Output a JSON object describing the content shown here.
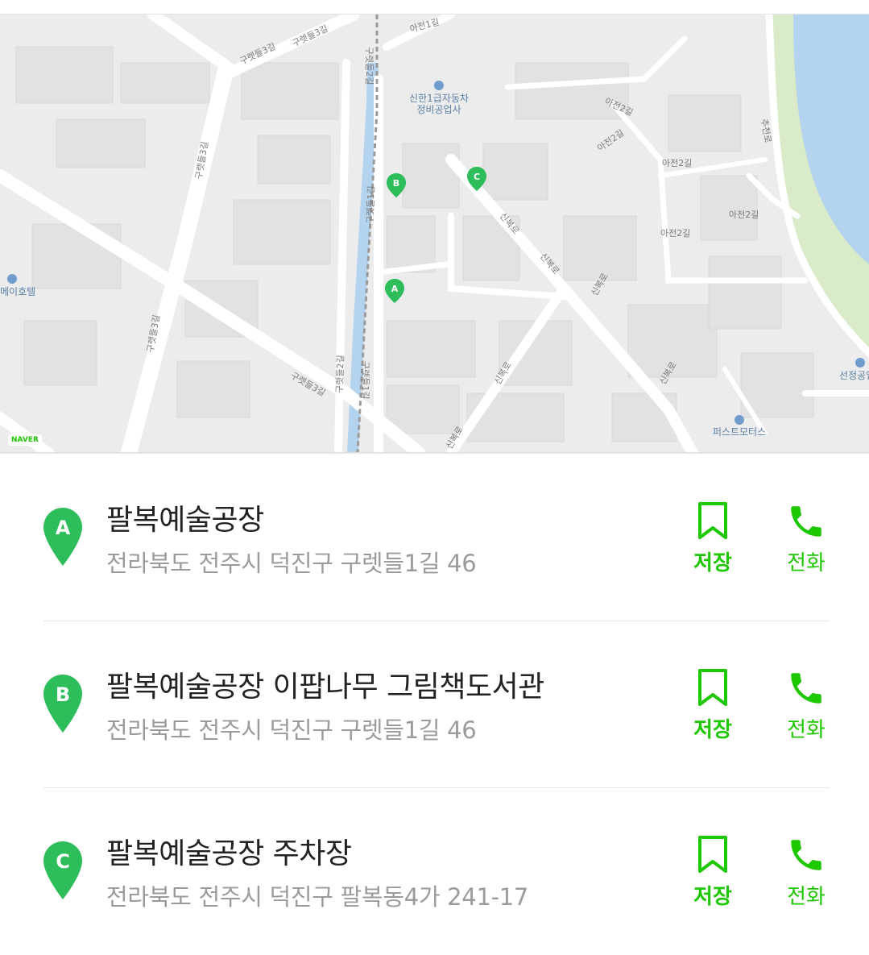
{
  "map": {
    "pins": [
      {
        "letter": "A"
      },
      {
        "letter": "B"
      },
      {
        "letter": "C"
      }
    ],
    "labels": {
      "road1": "구렛들3길",
      "road2": "구렛들3길",
      "road3": "구렛들3길",
      "road4": "구렛들2길",
      "road5": "구렛들1길",
      "road6": "구렛들2길",
      "road7": "신복로",
      "road8": "아전1길",
      "road9": "아전2길",
      "road10": "아전2길",
      "road11": "아전2길",
      "road12": "아전2길",
      "road13": "추천로",
      "poi1_line1": "신한1급자동차",
      "poi1_line2": "정비공업사",
      "poi2": "메이호텔",
      "poi3": "선정공업",
      "poi4": "퍼스트모터스"
    },
    "brand": "NAVER"
  },
  "results": [
    {
      "letter": "A",
      "name": "팔복예술공장",
      "address": "전라북도 전주시 덕진구 구렛들1길 46",
      "save_label": "저장",
      "call_label": "전화"
    },
    {
      "letter": "B",
      "name": "팔복예술공장 이팝나무 그림책도서관",
      "address": "전라북도 전주시 덕진구 구렛들1길 46",
      "save_label": "저장",
      "call_label": "전화"
    },
    {
      "letter": "C",
      "name": "팔복예술공장 주차장",
      "address": "전라북도 전주시 덕진구 팔복동4가 241-17",
      "save_label": "저장",
      "call_label": "전화"
    }
  ],
  "colors": {
    "accent": "#1ec800",
    "pin": "#2dbd5a",
    "river": "#b4d3ee",
    "park": "#d9ebc8"
  }
}
